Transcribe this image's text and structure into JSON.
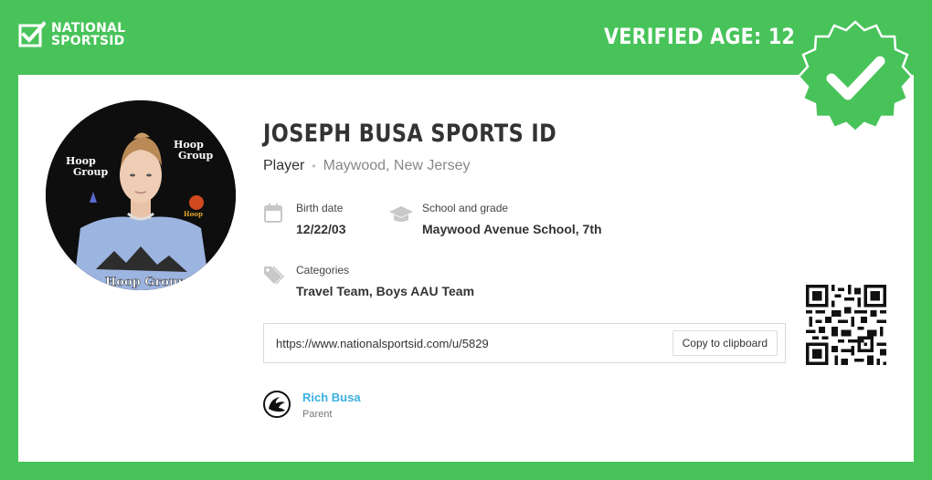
{
  "header": {
    "logo_line1": "NATIONAL",
    "logo_line2": "SPORTSID",
    "verified_age": "VERIFIED AGE: 12"
  },
  "profile": {
    "name": "JOSEPH BUSA SPORTS ID",
    "role": "Player",
    "separator": "•",
    "location": "Maywood, New Jersey",
    "birth_label": "Birth date",
    "birth_value": "12/22/03",
    "school_label": "School and grade",
    "school_value": "Maywood Avenue School, 7th",
    "categories_label": "Categories",
    "categories_value": "Travel Team, Boys AAU Team",
    "url": "https://www.nationalsportsid.com/u/5829",
    "copy_label": "Copy to clipboard"
  },
  "parent": {
    "name": "Rich Busa",
    "role": "Parent"
  },
  "photo_backdrop": {
    "text_line1": "Hoop",
    "text_line2": "Group",
    "shirt_text": "Hoop Group"
  },
  "colors": {
    "brand_green": "#48c35a",
    "link_blue": "#3ab0e2",
    "icon_gray": "#c8c8c8"
  }
}
